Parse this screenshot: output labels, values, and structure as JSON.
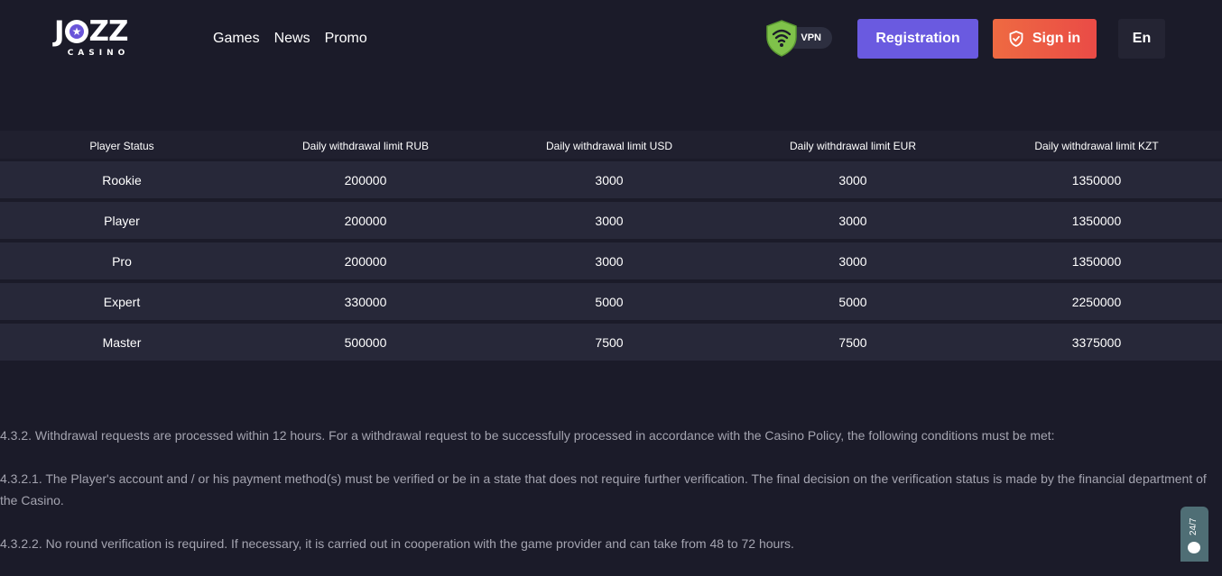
{
  "brand": {
    "logo_text": "JOZZ",
    "logo_sub": "CASINO"
  },
  "nav": {
    "items": [
      "Games",
      "News",
      "Promo"
    ]
  },
  "vpn": {
    "label": "VPN"
  },
  "header": {
    "registration_label": "Registration",
    "signin_label": "Sign in",
    "language_label": "En"
  },
  "table": {
    "headers": [
      "Player Status",
      "Daily withdrawal limit RUB",
      "Daily withdrawal limit USD",
      "Daily withdrawal limit EUR",
      "Daily withdrawal limit KZT"
    ],
    "rows": [
      [
        "Rookie",
        "200000",
        "3000",
        "3000",
        "1350000"
      ],
      [
        "Player",
        "200000",
        "3000",
        "3000",
        "1350000"
      ],
      [
        "Pro",
        "200000",
        "3000",
        "3000",
        "1350000"
      ],
      [
        "Expert",
        "330000",
        "5000",
        "5000",
        "2250000"
      ],
      [
        "Master",
        "500000",
        "7500",
        "7500",
        "3375000"
      ]
    ]
  },
  "paragraphs": [
    "4.3.2. Withdrawal requests are processed within 12 hours. For a withdrawal request to be successfully processed in accordance with the Casino Policy, the following conditions must be met:",
    "4.3.2.1. The Player's account and / or his payment method(s) must be verified or be in a state that does not require further verification. The final decision on the verification status is made by the financial department of the Casino.",
    "4.3.2.2. No round verification is required. If necessary, it is carried out in cooperation with the game provider and can take from 48 to 72 hours."
  ],
  "chat": {
    "label": "24/7"
  },
  "colors": {
    "background": "#1b1b29",
    "registration": "#6a5ae0",
    "signin": "#ea4b46",
    "vpn_shield": "#7fc24a",
    "chat_tab": "#4f6e75"
  }
}
